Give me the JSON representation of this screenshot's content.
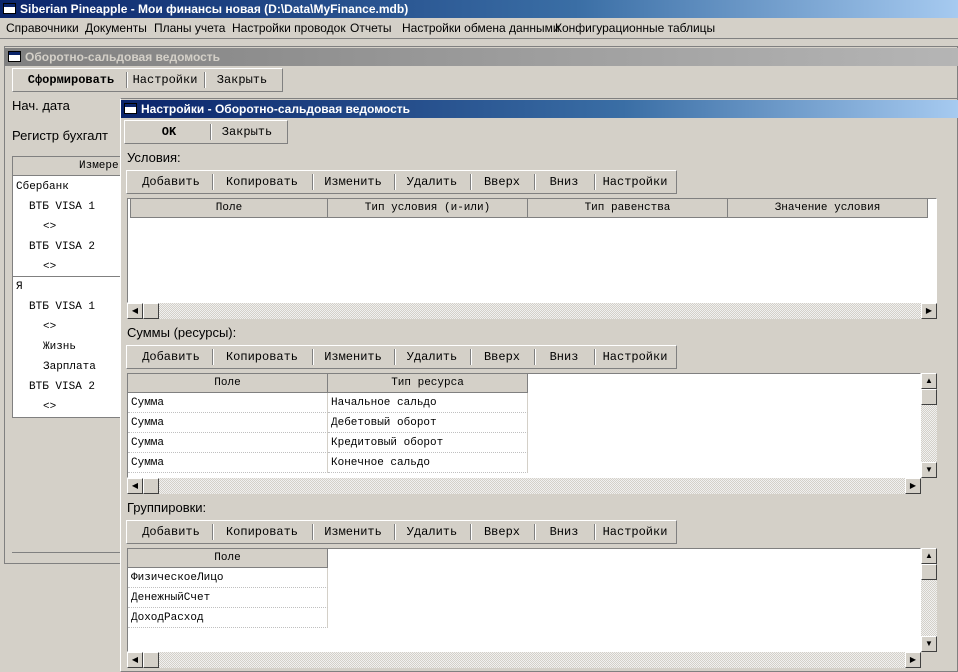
{
  "app": {
    "title": "Siberian Pineapple - Мои финансы новая (D:\\Data\\MyFinance.mdb)"
  },
  "menu": [
    "Справочники",
    "Документы",
    "Планы учета",
    "Настройки проводок",
    "Отчеты",
    "Настройки обмена данными",
    "Конфигурационные таблицы"
  ],
  "report_window": {
    "title": "Оборотно-сальдовая ведомость",
    "toolbar": {
      "form": "Сформировать",
      "settings": "Настройки",
      "close": "Закрыть"
    },
    "start_date_label": "Нач. дата",
    "register_label": "Регистр бухгалт",
    "tree_header": "Измере",
    "tree_rows": [
      {
        "text": "Сбербанк",
        "indent": 0
      },
      {
        "text": "ВТБ VISA 1",
        "indent": 1
      },
      {
        "text": "<>",
        "indent": 2
      },
      {
        "text": "ВТБ VISA 2",
        "indent": 1
      },
      {
        "text": "<>",
        "indent": 2
      },
      {
        "text": "Я",
        "indent": 0
      },
      {
        "text": "ВТБ VISA 1",
        "indent": 1
      },
      {
        "text": "<>",
        "indent": 2
      },
      {
        "text": "Жизнь",
        "indent": 2
      },
      {
        "text": "Зарплата",
        "indent": 2
      },
      {
        "text": "ВТБ VISA 2",
        "indent": 1
      },
      {
        "text": "<>",
        "indent": 2
      }
    ]
  },
  "settings_window": {
    "title": "Настройки - Оборотно-сальдовая ведомость",
    "toolbar": {
      "ok": "OK",
      "close": "Закрыть"
    },
    "conditions": {
      "label": "Условия:",
      "columns": [
        "Поле",
        "Тип условия (и-или)",
        "Тип равенства",
        "Значение условия"
      ]
    },
    "sums": {
      "label": "Суммы (ресурсы):",
      "columns": [
        "Поле",
        "Тип ресурса"
      ],
      "rows": [
        [
          "Сумма",
          "Начальное сальдо"
        ],
        [
          "Сумма",
          "Дебетовый оборот"
        ],
        [
          "Сумма",
          "Кредитовый оборот"
        ],
        [
          "Сумма",
          "Конечное сальдо"
        ]
      ]
    },
    "groupings": {
      "label": "Группировки:",
      "columns": [
        "Поле"
      ],
      "rows": [
        "ФизическоеЛицо",
        "ДенежныйСчет",
        "ДоходРасход"
      ]
    },
    "section_toolbar": {
      "add": "Добавить",
      "copy": "Копировать",
      "edit": "Изменить",
      "delete": "Удалить",
      "up": "Вверх",
      "down": "Вниз",
      "settings": "Настройки"
    }
  },
  "colors": {
    "title_active": "#0a246a",
    "face": "#d4d0c8",
    "desktop": "#808080"
  }
}
